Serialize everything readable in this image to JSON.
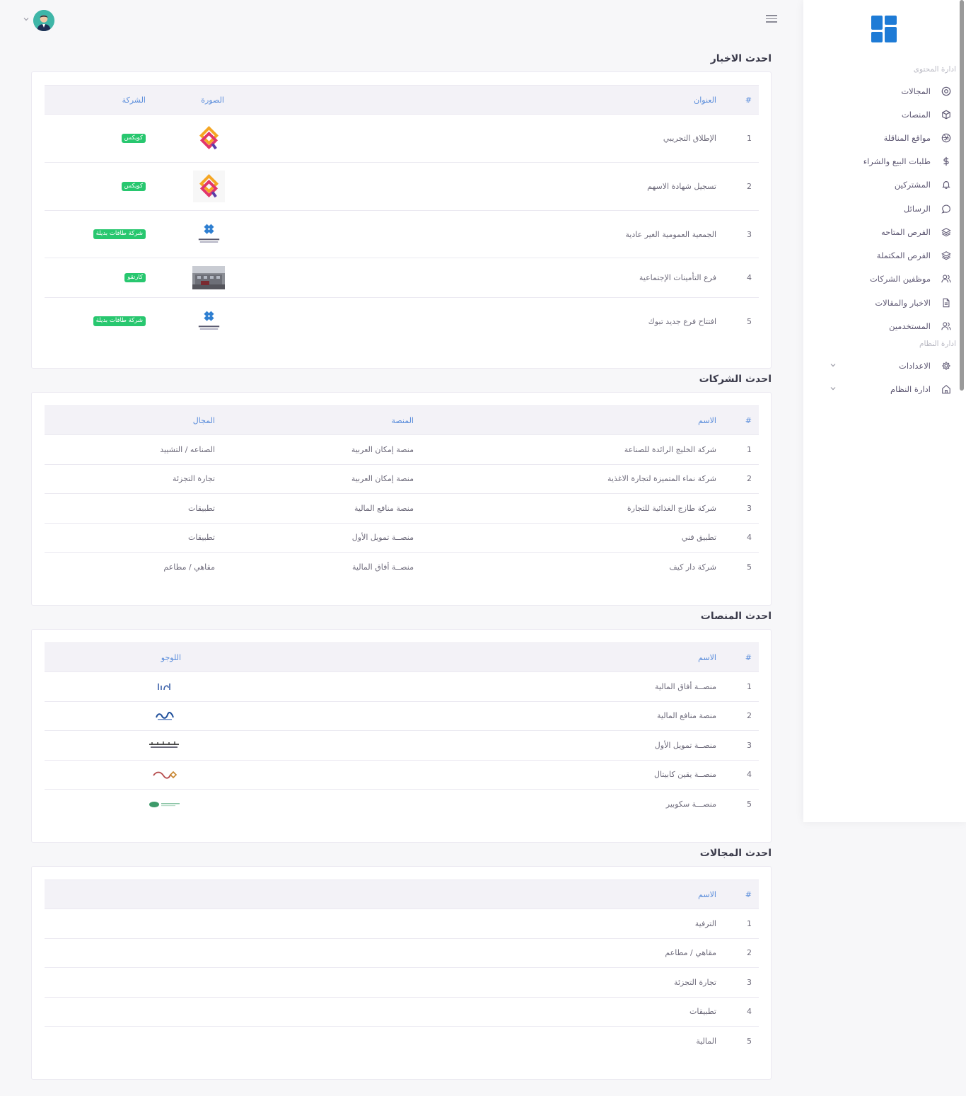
{
  "sidebar": {
    "content_section": "ادارة المحتوى",
    "system_section": "ادارة النظام",
    "items": [
      {
        "label": "المجالات",
        "icon": "at-icon"
      },
      {
        "label": "المنصات",
        "icon": "box-icon"
      },
      {
        "label": "مواقع المناقلة",
        "icon": "aperture-icon"
      },
      {
        "label": "طلبات البيع والشراء",
        "icon": "dollar-icon"
      },
      {
        "label": "المشتركين",
        "icon": "bell-icon"
      },
      {
        "label": "الرسائل",
        "icon": "message-icon"
      },
      {
        "label": "الفرص المتاحه",
        "icon": "layers-icon"
      },
      {
        "label": "الفرص المكتملة",
        "icon": "layers-icon"
      },
      {
        "label": "موظفين الشركات",
        "icon": "users-icon"
      },
      {
        "label": "الاخبار والمقالات",
        "icon": "file-icon"
      },
      {
        "label": "المستخدمين",
        "icon": "users-icon"
      }
    ],
    "system_items": [
      {
        "label": "الاعدادات",
        "icon": "gear-icon"
      },
      {
        "label": "ادارة النظام",
        "icon": "home-icon"
      }
    ]
  },
  "news": {
    "title": "احدث الاخبار",
    "headers": {
      "hash": "#",
      "title": "العنوان",
      "image": "الصورة",
      "company": "الشركة"
    },
    "rows": [
      {
        "n": "1",
        "title": "الإطلاق التجريبي",
        "image": "qwikx-logo",
        "company": "كويكس"
      },
      {
        "n": "2",
        "title": "تسجيل شهادة الاسهم",
        "image": "qwikx-logo",
        "company": "كويكس"
      },
      {
        "n": "3",
        "title": "الجمعية العمومية الغير عادية",
        "image": "taqat-logo",
        "company": "شركة طاقات بديلة"
      },
      {
        "n": "4",
        "title": "فرع التأمينات الإجتماعية",
        "image": "building-photo",
        "company": "كارتقو"
      },
      {
        "n": "5",
        "title": "افتتاح فرع جديد تبوك",
        "image": "taqat-logo",
        "company": "شركة طاقات بديلة"
      }
    ]
  },
  "companies": {
    "title": "احدث الشركات",
    "headers": {
      "hash": "#",
      "name": "الاسم",
      "platform": "المنصة",
      "field": "المجال"
    },
    "rows": [
      {
        "n": "1",
        "name": "شركة الخليج الرائدة للصناعة",
        "platform": "منصة إمكان العربية",
        "field": "الصناعه / التشييد"
      },
      {
        "n": "2",
        "name": "شركة نماء المتميزة لتجارة الاغذية",
        "platform": "منصة إمكان العربية",
        "field": "تجارة التجزئة"
      },
      {
        "n": "3",
        "name": "شركة طازج الغذائية للتجارة",
        "platform": "منصة منافع المالية",
        "field": "تطبيقات"
      },
      {
        "n": "4",
        "name": "تطبيق فني",
        "platform": "منصــة تمويل الأول",
        "field": "تطبيقات"
      },
      {
        "n": "5",
        "name": "شركة دار كيف",
        "platform": "منصــة أفاق المالية",
        "field": "مقاهي / مطاعم"
      }
    ]
  },
  "platforms": {
    "title": "احدث المنصات",
    "headers": {
      "hash": "#",
      "name": "الاسم",
      "logo": "اللوجو"
    },
    "rows": [
      {
        "n": "1",
        "name": "منصــة أفاق المالية",
        "logo": "afaq-logo"
      },
      {
        "n": "2",
        "name": "منصة منافع المالية",
        "logo": "manafa-logo"
      },
      {
        "n": "3",
        "name": "منصــة تمويل الأول",
        "logo": "tamweel-logo"
      },
      {
        "n": "4",
        "name": "منصــة يقين كابيتال",
        "logo": "yaqeen-logo"
      },
      {
        "n": "5",
        "name": "منصـــة سكوبير",
        "logo": "scopeer-logo"
      }
    ]
  },
  "fields": {
    "title": "احدث المجالات",
    "headers": {
      "hash": "#",
      "name": "الاسم"
    },
    "rows": [
      {
        "n": "1",
        "name": "الترفية"
      },
      {
        "n": "2",
        "name": "مقاهي / مطاعم"
      },
      {
        "n": "3",
        "name": "تجارة التجزئة"
      },
      {
        "n": "4",
        "name": "تطبيقات"
      },
      {
        "n": "5",
        "name": "المالية"
      }
    ]
  },
  "colors": {
    "accent": "#1e7bd6",
    "header_text": "#5a8ddb",
    "badge": "#28c76f"
  }
}
